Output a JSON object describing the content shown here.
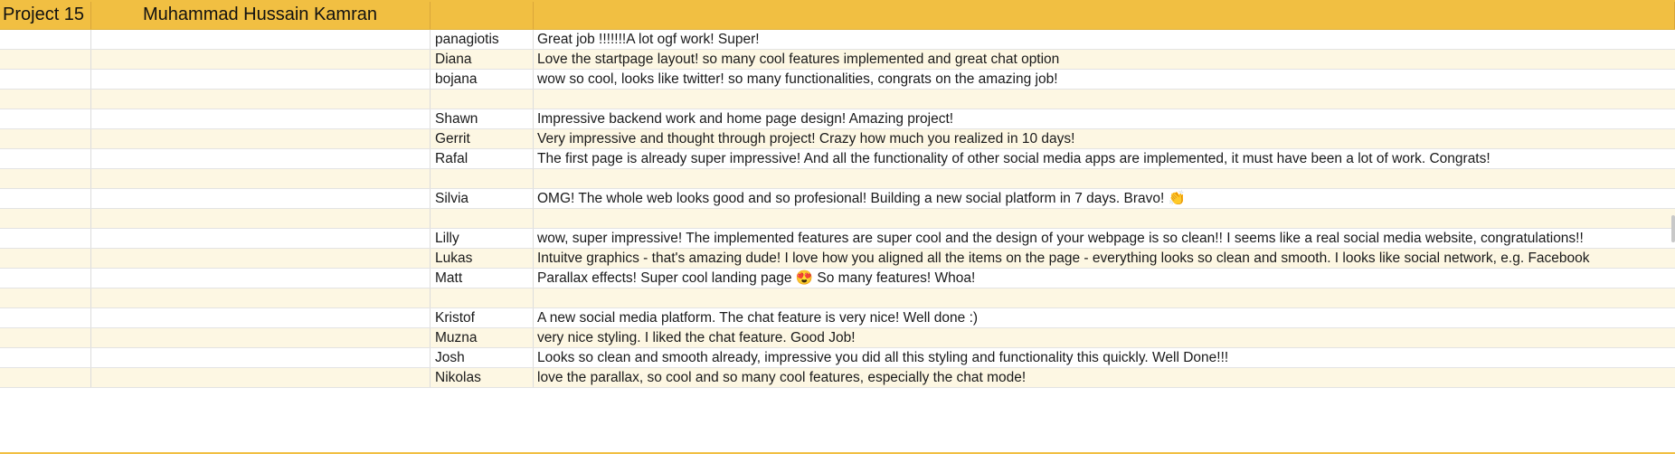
{
  "header": {
    "project": "Project 15",
    "owner": "Muhammad Hussain Kamran"
  },
  "rows": [
    {
      "name": "panagiotis",
      "comment": "Great job !!!!!!!A lot ogf work!  Super!"
    },
    {
      "name": "Diana",
      "comment": "Love the startpage layout! so many cool features implemented and great chat option"
    },
    {
      "name": "bojana",
      "comment": "wow so cool, looks like twitter! so many functionalities, congrats on the amazing job!"
    },
    {
      "name": "",
      "comment": ""
    },
    {
      "name": "Shawn",
      "comment": "Impressive backend work and home page design! Amazing project!"
    },
    {
      "name": "Gerrit",
      "comment": "Very impressive and thought through project! Crazy how much you realized in 10 days!"
    },
    {
      "name": "Rafal",
      "comment": "The first page is already super impressive! And all the functionality of other social media apps are implemented, it must have been a lot of work. Congrats!"
    },
    {
      "name": "",
      "comment": ""
    },
    {
      "name": "Silvia",
      "comment": "OMG! The whole web looks good and so profesional! Building a new social platform in 7 days. Bravo! 👏"
    },
    {
      "name": "",
      "comment": ""
    },
    {
      "name": "Lilly",
      "comment": "wow, super impressive! The implemented features are super cool and the design of your webpage is so clean!! I seems like a real social media website, congratulations!!"
    },
    {
      "name": "Lukas",
      "comment": "Intuitve graphics - that's amazing dude! I love how you aligned all the items on the page - everything looks so clean and smooth. I looks like social network, e.g. Facebook"
    },
    {
      "name": "Matt",
      "comment": "Parallax effects! Super cool landing page 😍 So many features! Whoa!"
    },
    {
      "name": "",
      "comment": ""
    },
    {
      "name": "Kristof",
      "comment": "A new social media platform. The chat feature is very nice! Well done :)"
    },
    {
      "name": "Muzna",
      "comment": "very nice styling. I liked the chat feature. Good Job!"
    },
    {
      "name": "Josh",
      "comment": "Looks so clean and smooth already, impressive you did all this styling and functionality this quickly. Well Done!!!"
    },
    {
      "name": "Nikolas",
      "comment": "love the parallax, so cool and so many cool features, especially the chat mode!"
    }
  ],
  "colors": {
    "header": "#f1bf42",
    "stripe": "#fdf7e3",
    "grid": "#dcdcdc"
  }
}
